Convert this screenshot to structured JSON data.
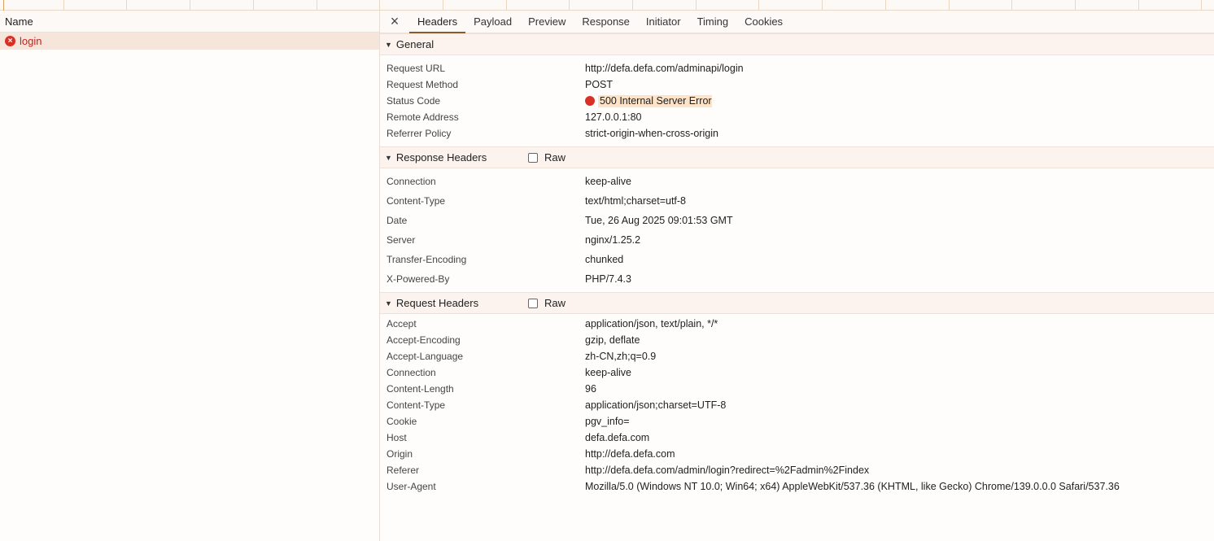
{
  "left": {
    "column_header": "Name",
    "requests": [
      {
        "name": "login",
        "status": "error"
      }
    ]
  },
  "tabs": {
    "close": "×",
    "items": [
      "Headers",
      "Payload",
      "Preview",
      "Response",
      "Initiator",
      "Timing",
      "Cookies"
    ],
    "active": "Headers"
  },
  "general": {
    "title": "General",
    "rows": [
      {
        "key": "Request URL",
        "value": "http://defa.defa.com/adminapi/login"
      },
      {
        "key": "Request Method",
        "value": "POST"
      },
      {
        "key": "Status Code",
        "value": "500 Internal Server Error"
      },
      {
        "key": "Remote Address",
        "value": "127.0.0.1:80"
      },
      {
        "key": "Referrer Policy",
        "value": "strict-origin-when-cross-origin"
      }
    ]
  },
  "response_headers": {
    "title": "Response Headers",
    "raw_label": "Raw",
    "rows": [
      {
        "key": "Connection",
        "value": "keep-alive"
      },
      {
        "key": "Content-Type",
        "value": "text/html;charset=utf-8"
      },
      {
        "key": "Date",
        "value": "Tue, 26 Aug 2025 09:01:53 GMT"
      },
      {
        "key": "Server",
        "value": "nginx/1.25.2"
      },
      {
        "key": "Transfer-Encoding",
        "value": "chunked"
      },
      {
        "key": "X-Powered-By",
        "value": "PHP/7.4.3"
      }
    ]
  },
  "request_headers": {
    "title": "Request Headers",
    "raw_label": "Raw",
    "rows": [
      {
        "key": "Accept",
        "value": "application/json, text/plain, */*"
      },
      {
        "key": "Accept-Encoding",
        "value": "gzip, deflate"
      },
      {
        "key": "Accept-Language",
        "value": "zh-CN,zh;q=0.9"
      },
      {
        "key": "Connection",
        "value": "keep-alive"
      },
      {
        "key": "Content-Length",
        "value": "96"
      },
      {
        "key": "Content-Type",
        "value": "application/json;charset=UTF-8"
      },
      {
        "key": "Cookie",
        "value": "pgv_info="
      },
      {
        "key": "Host",
        "value": "defa.defa.com"
      },
      {
        "key": "Origin",
        "value": "http://defa.defa.com"
      },
      {
        "key": "Referer",
        "value": "http://defa.defa.com/admin/login?redirect=%2Fadmin%2Findex"
      },
      {
        "key": "User-Agent",
        "value": "Mozilla/5.0 (Windows NT 10.0; Win64; x64) AppleWebKit/537.36 (KHTML, like Gecko) Chrome/139.0.0.0 Safari/537.36"
      }
    ]
  },
  "colors": {
    "error": "#d93025",
    "active_tab_underline": "#8b5a2b",
    "status_highlight": "#fde3c8"
  }
}
